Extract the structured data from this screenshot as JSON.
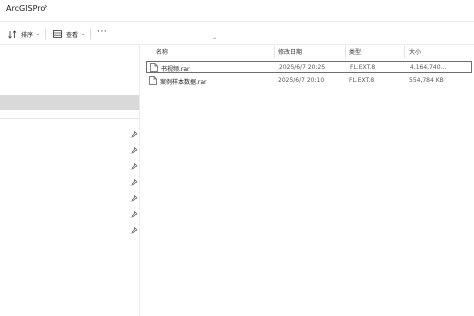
{
  "breadcrumb": {
    "path_label": "ArcGISPro",
    "separator_icon": "chevron-right-icon"
  },
  "toolbar": {
    "sort_label": "排序",
    "view_label": "查看",
    "more_label": "···"
  },
  "columns": {
    "name": "名称",
    "date": "修改日期",
    "type": "类型",
    "size": "大小"
  },
  "files": [
    {
      "name": "书视频.rar",
      "date": "2025/6/7 20:25",
      "type": "FL.EXT.8",
      "size": "4,164,740...",
      "selected": true
    },
    {
      "name": "案例样本数据.rar",
      "date": "2025/6/7 20:10",
      "type": "FL.EXT.8",
      "size": "554,784 KB",
      "selected": false
    }
  ],
  "nav_pane": {
    "pinned_item_icon": "pin-icon"
  },
  "colors": {
    "selection_border": "#6e6e6e",
    "nav_highlight": "#d9d9d9"
  }
}
